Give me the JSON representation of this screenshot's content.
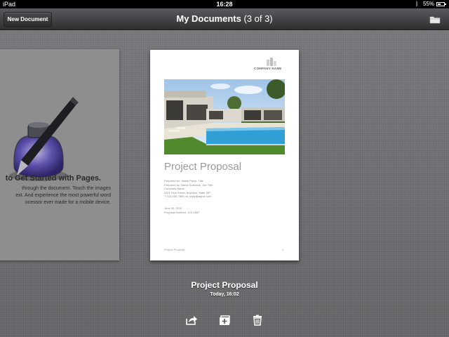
{
  "status_bar": {
    "carrier": "iPad",
    "time": "16:28",
    "battery_percent": "55%",
    "battery_level": 0.55
  },
  "toolbar": {
    "new_document_label": "New Document",
    "title": "My Documents",
    "count": "(3 of 3)"
  },
  "left_card": {
    "heading": "to Get Started with Pages.",
    "body_lines": [
      "through the document. Touch the images",
      "ext. And experience the most powerful word",
      "ocessor ever made for a mobile device."
    ]
  },
  "document": {
    "company_name": "COMPANY NAME",
    "title": "Project Proposal",
    "meta_lines": [
      "Prepared for: Name Place, Title",
      "Prepared by: Name Surname, Job Title",
      "Company Name",
      "4321 First Street, Anytown, State ZIP",
      "T 123-456-7890   no_reply@apple.com"
    ],
    "date_lines": [
      "June 30, 2010",
      "Proposal Number: 123-4567"
    ],
    "footer": "Project Proposal",
    "page_number": "1"
  },
  "caption": {
    "title": "Project Proposal",
    "date": "Today, 16:02"
  },
  "icons": [
    "folder-icon",
    "share-icon",
    "duplicate-icon",
    "trash-icon",
    "pages-logo-icon"
  ],
  "colors": {
    "background": "#6f6f73",
    "toolbar": "#3a3a3d",
    "pool": "#2f9fd6",
    "lawn": "#4f8a2c"
  }
}
